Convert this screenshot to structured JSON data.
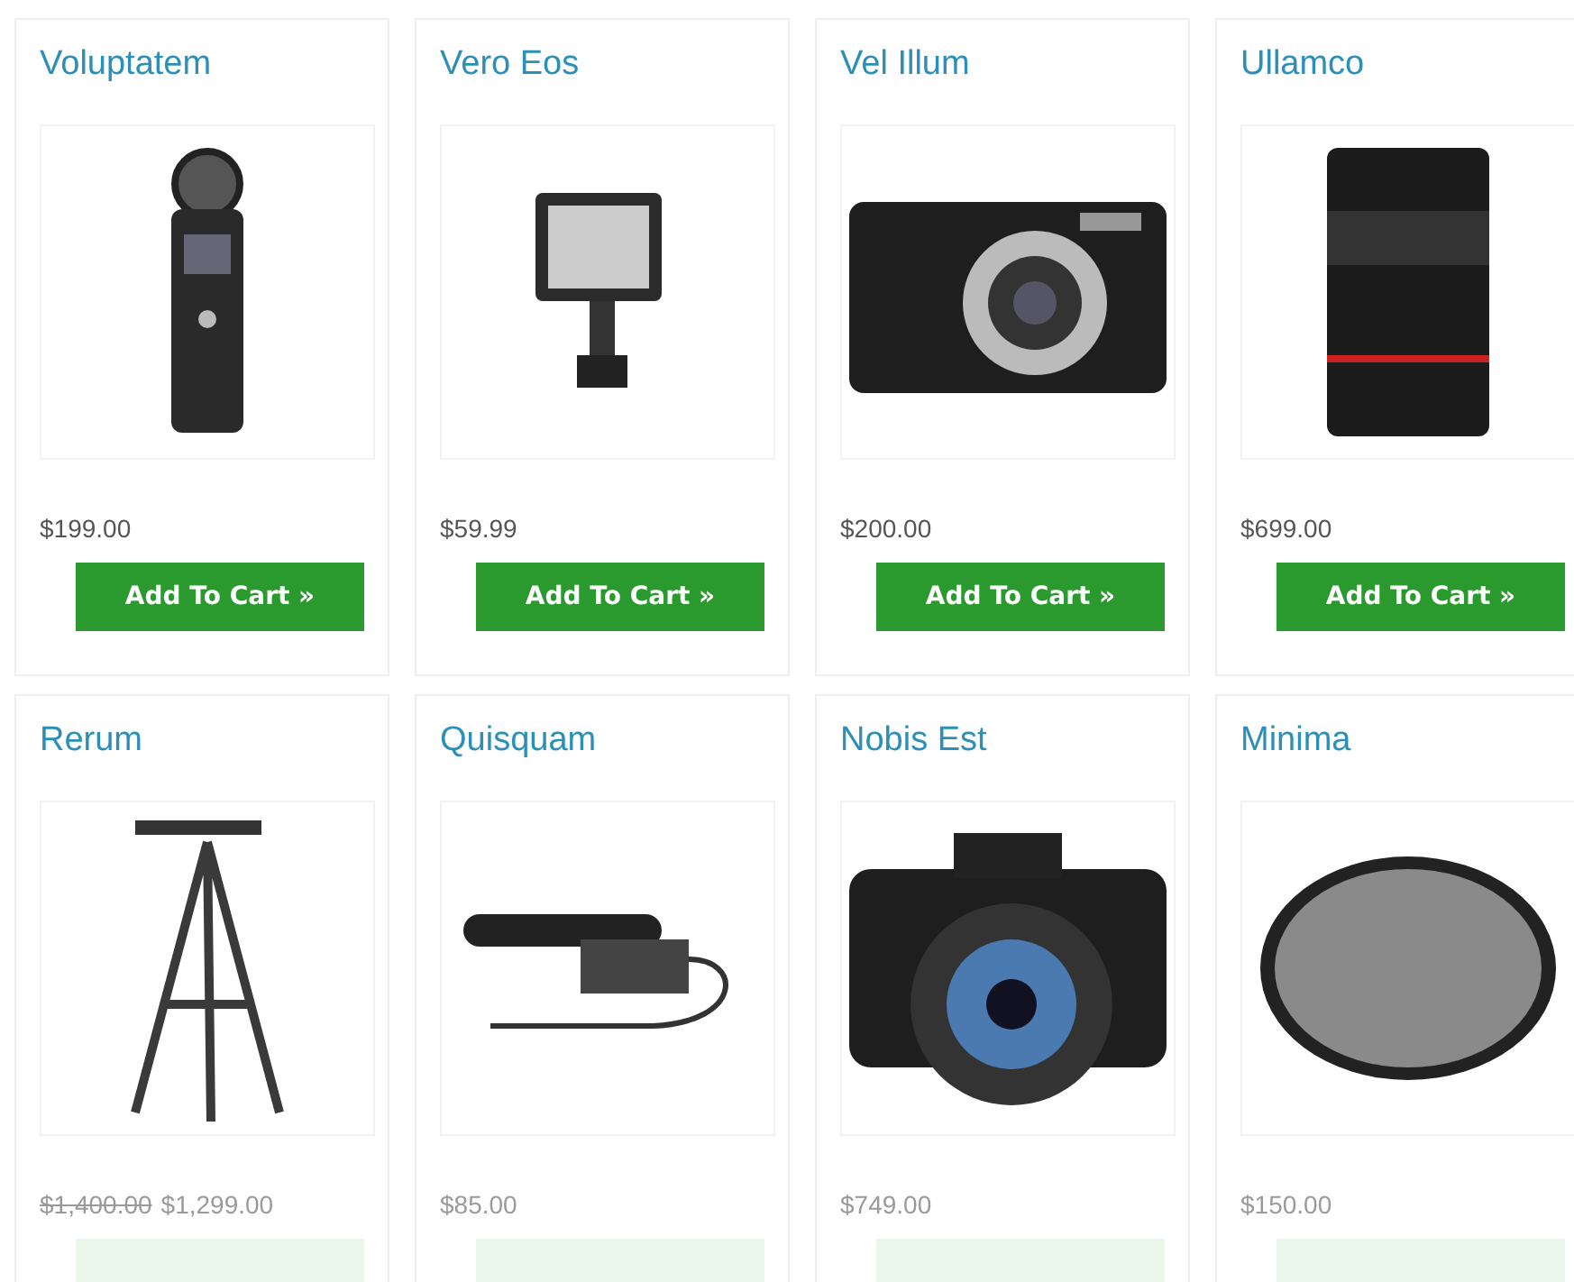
{
  "products": [
    {
      "name": "Voluptatem",
      "kind": "recorder",
      "price": "$199.00",
      "faded": false,
      "button_label": "Add To Cart »"
    },
    {
      "name": "Vero Eos",
      "kind": "light",
      "price": "$59.99",
      "faded": false,
      "button_label": "Add To Cart »"
    },
    {
      "name": "Vel Illum",
      "kind": "compact",
      "price": "$200.00",
      "faded": false,
      "button_label": "Add To Cart »"
    },
    {
      "name": "Ullamco",
      "kind": "lens",
      "price": "$699.00",
      "faded": false,
      "button_label": "Add To Cart »"
    },
    {
      "name": "Rerum",
      "kind": "tripod",
      "old_price": "$1,400.00",
      "price": "$1,299.00",
      "faded": true
    },
    {
      "name": "Quisquam",
      "kind": "microphone",
      "price": "$85.00",
      "faded": true
    },
    {
      "name": "Nobis Est",
      "kind": "dslr",
      "price": "$749.00",
      "faded": true
    },
    {
      "name": "Minima",
      "kind": "filter",
      "price": "$150.00",
      "faded": true
    }
  ]
}
